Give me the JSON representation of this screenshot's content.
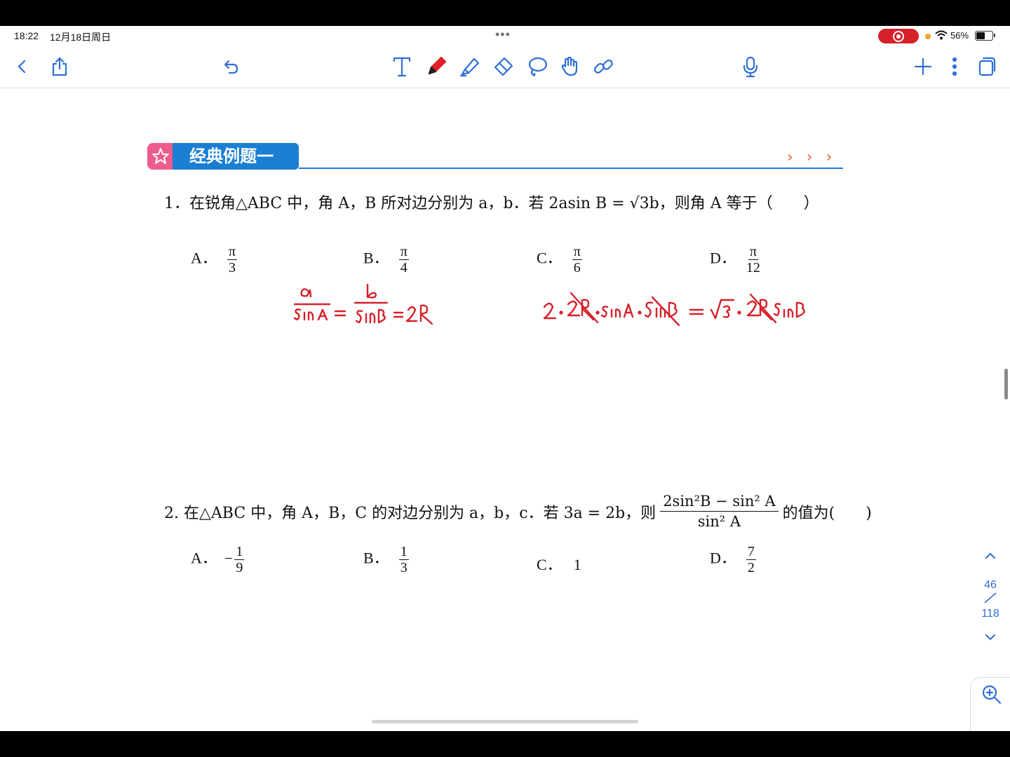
{
  "status": {
    "time": "18:22",
    "date": "12月18日周日",
    "battery": "56%",
    "battery_level": 0.56
  },
  "toolbar": {
    "items": [
      "back-icon",
      "share-icon",
      "undo-icon",
      "text-tool-icon",
      "pen-tool-icon",
      "highlighter-icon",
      "eraser-icon",
      "lasso-icon",
      "hand-icon",
      "link-icon",
      "microphone-icon",
      "add-icon",
      "more-icon",
      "pages-icon"
    ]
  },
  "section": {
    "title": "经典例题一",
    "chevrons": "› › ›"
  },
  "q1": {
    "text": "1．在锐角△ABC 中，角 A，B 所对边分别为 a，b．若 2asin B = √3b，则角 A 等于（　　）",
    "options": [
      {
        "label": "A．",
        "num": "π",
        "den": "3"
      },
      {
        "label": "B．",
        "num": "π",
        "den": "4"
      },
      {
        "label": "C．",
        "num": "π",
        "den": "6"
      },
      {
        "label": "D．",
        "num": "π",
        "den": "12"
      }
    ]
  },
  "q2": {
    "prefix": "2. 在△ABC 中，角 A，B，C 的对边分别为 a，b，c．若 3a = 2b，则",
    "frac_num": "2sin²B − sin² A",
    "frac_den": "sin² A",
    "suffix": "的值为(　　)",
    "options": [
      {
        "label": "A．",
        "sign": "−",
        "num": "1",
        "den": "9"
      },
      {
        "label": "B．",
        "sign": "",
        "num": "1",
        "den": "3"
      },
      {
        "label": "C．",
        "value": "1"
      },
      {
        "label": "D．",
        "sign": "",
        "num": "7",
        "den": "2"
      }
    ]
  },
  "pager": {
    "current": "46",
    "total": "118"
  }
}
